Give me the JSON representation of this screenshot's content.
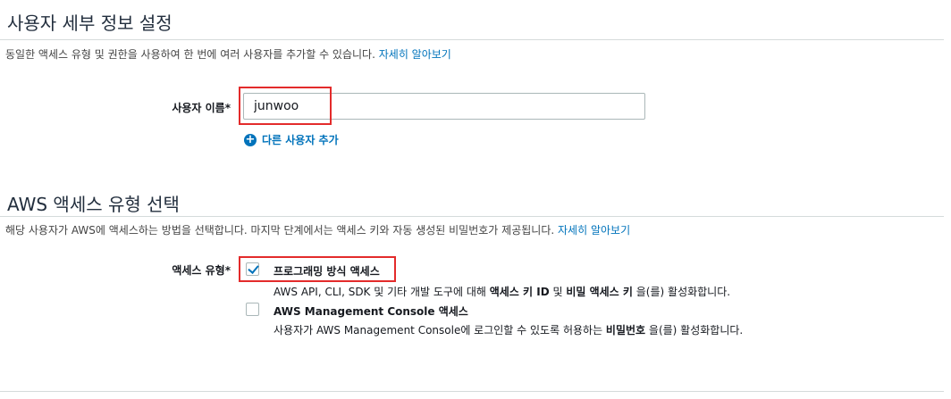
{
  "user_details": {
    "title": "사용자 세부 정보 설정",
    "description": "동일한 액세스 유형 및 권한을 사용하여 한 번에 여러 사용자를 추가할 수 있습니다.",
    "learn_more": "자세히 알아보기",
    "username_label": "사용자 이름*",
    "username_value": "junwoo",
    "add_user_label": "다른 사용자 추가"
  },
  "access_type": {
    "title": "AWS 액세스 유형 선택",
    "description": "해당 사용자가 AWS에 액세스하는 방법을 선택합니다. 마지막 단계에서는 액세스 키와 자동 생성된 비밀번호가 제공됩니다.",
    "learn_more": "자세히 알아보기",
    "label": "액세스 유형*",
    "options": [
      {
        "title": "프로그래밍 방식 액세스",
        "checked": true,
        "desc_pre": "AWS API, CLI, SDK 및 기타 개발 도구에 대해 ",
        "desc_b1": "액세스 키 ID",
        "desc_mid": " 및 ",
        "desc_b2": "비밀 액세스 키",
        "desc_post": " 을(를) 활성화합니다."
      },
      {
        "title": "AWS Management Console 액세스",
        "checked": false,
        "desc_pre": "사용자가 AWS Management Console에 로그인할 수 있도록 허용하는 ",
        "desc_b1": "비밀번호",
        "desc_post": " 을(를) 활성화합니다."
      }
    ]
  },
  "colors": {
    "link": "#0073bb",
    "highlight": "#e32b2b",
    "title": "#232f3e"
  }
}
